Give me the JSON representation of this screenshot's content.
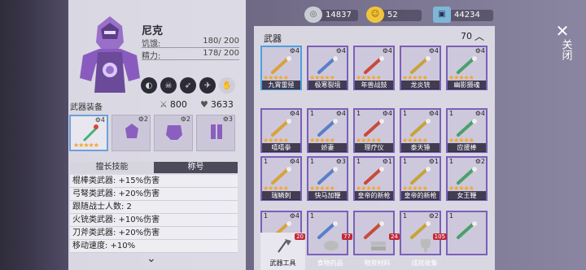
{
  "hero": {
    "name": "尼克",
    "hunger_label": "饥饿:",
    "hunger_value": "180/ 200",
    "energy_label": "精力:",
    "energy_value": "178/ 200"
  },
  "equip": {
    "label": "武器装备",
    "attack": "800",
    "health": "3633",
    "slots": [
      {
        "level": "4",
        "active": true
      },
      {
        "level": "2"
      },
      {
        "level": "2"
      },
      {
        "level": "3"
      }
    ]
  },
  "tabs": [
    "擅长技能",
    "称号"
  ],
  "skills": [
    "棍棒类武器: +15%伤害",
    "弓弩类武器: +20%伤害",
    "跟随战士人数: 2",
    "火铳类武器: +10%伤害",
    "刀斧类武器: +20%伤害",
    "移动速度: +10%"
  ],
  "currencies": [
    {
      "name": "coins-stack",
      "value": "14837"
    },
    {
      "name": "gold-coin",
      "value": "52"
    },
    {
      "name": "cash",
      "value": "44234"
    }
  ],
  "weapons": {
    "title": "武器",
    "count": "70",
    "cards": [
      {
        "count": "",
        "level": "4",
        "stars": "★★★★★",
        "name": "九霄雷殛",
        "sel": true
      },
      {
        "count": "",
        "level": "4",
        "stars": "★★★★★",
        "name": "极寒裂境"
      },
      {
        "count": "",
        "level": "4",
        "stars": "★★★★★",
        "name": "年兽战鼓"
      },
      {
        "count": "",
        "level": "4",
        "stars": "★★★★★",
        "name": "龙炎铳"
      },
      {
        "count": "",
        "level": "4",
        "stars": "★★★★★",
        "name": "幽影摄魂"
      },
      {
        "count": "",
        "level": "4",
        "stars": "★★★★★",
        "name": "嘻嘻拳"
      },
      {
        "count": "1",
        "level": "4",
        "stars": "★★★★★",
        "name": "娇妻"
      },
      {
        "count": "1",
        "level": "4",
        "stars": "★★★★★",
        "name": "理疗仪"
      },
      {
        "count": "1",
        "level": "4",
        "stars": "★★★★★",
        "name": "泰天锤"
      },
      {
        "count": "1",
        "level": "4",
        "stars": "★★★★★",
        "name": "应援棒"
      },
      {
        "count": "1",
        "level": "4",
        "stars": "★★★★★",
        "name": "瑞鳞刺"
      },
      {
        "count": "1",
        "level": "3",
        "stars": "★★★★★",
        "name": "快马加鞭"
      },
      {
        "count": "1",
        "level": "1",
        "stars": "★★★★★",
        "name": "皇帝的新枪"
      },
      {
        "count": "1",
        "level": "1",
        "stars": "★★★★★",
        "name": "皇帝的新枪"
      },
      {
        "count": "1",
        "level": "2",
        "stars": "★★★★★",
        "name": "女王鞭"
      },
      {
        "count": "1",
        "level": "4",
        "stars": "",
        "name": ""
      },
      {
        "count": "1",
        "level": "",
        "stars": "",
        "name": ""
      },
      {
        "count": "",
        "level": "",
        "stars": "",
        "name": ""
      },
      {
        "count": "1",
        "level": "2",
        "stars": "",
        "name": ""
      },
      {
        "count": "1",
        "level": "",
        "stars": "",
        "name": ""
      }
    ]
  },
  "categories": [
    {
      "label": "武器工具",
      "badge": "20",
      "active": true
    },
    {
      "label": "食物药品",
      "badge": "77"
    },
    {
      "label": "物资材料",
      "badge": "24"
    },
    {
      "label": "成就收集",
      "badge": "105"
    }
  ],
  "close": {
    "label": "关闭"
  }
}
